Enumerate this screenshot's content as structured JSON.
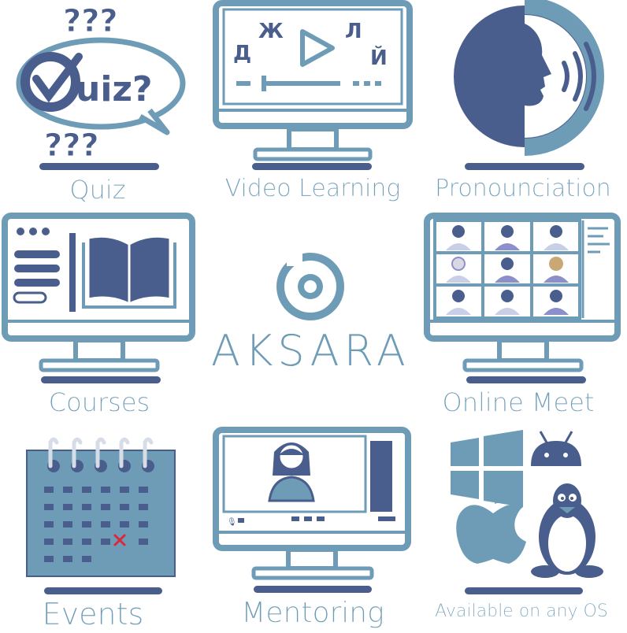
{
  "colors": {
    "primary": "#6e9cb7",
    "dark": "#4a5e8d",
    "light": "#e6eef4",
    "accent": "#d9283b"
  },
  "brand": {
    "name": "AKSARA"
  },
  "features": {
    "quiz": {
      "label": "Quiz",
      "badge_text": "uiz?"
    },
    "video": {
      "label": "Video Learning",
      "letters": [
        "Д",
        "Ж",
        "Л",
        "Й"
      ]
    },
    "pronunciation": {
      "label": "Pronounciation"
    },
    "courses": {
      "label": "Courses"
    },
    "meet": {
      "label": "Online Meet"
    },
    "events": {
      "label": "Events"
    },
    "mentoring": {
      "label": "Mentoring"
    },
    "os": {
      "label": "Available on any OS"
    }
  }
}
